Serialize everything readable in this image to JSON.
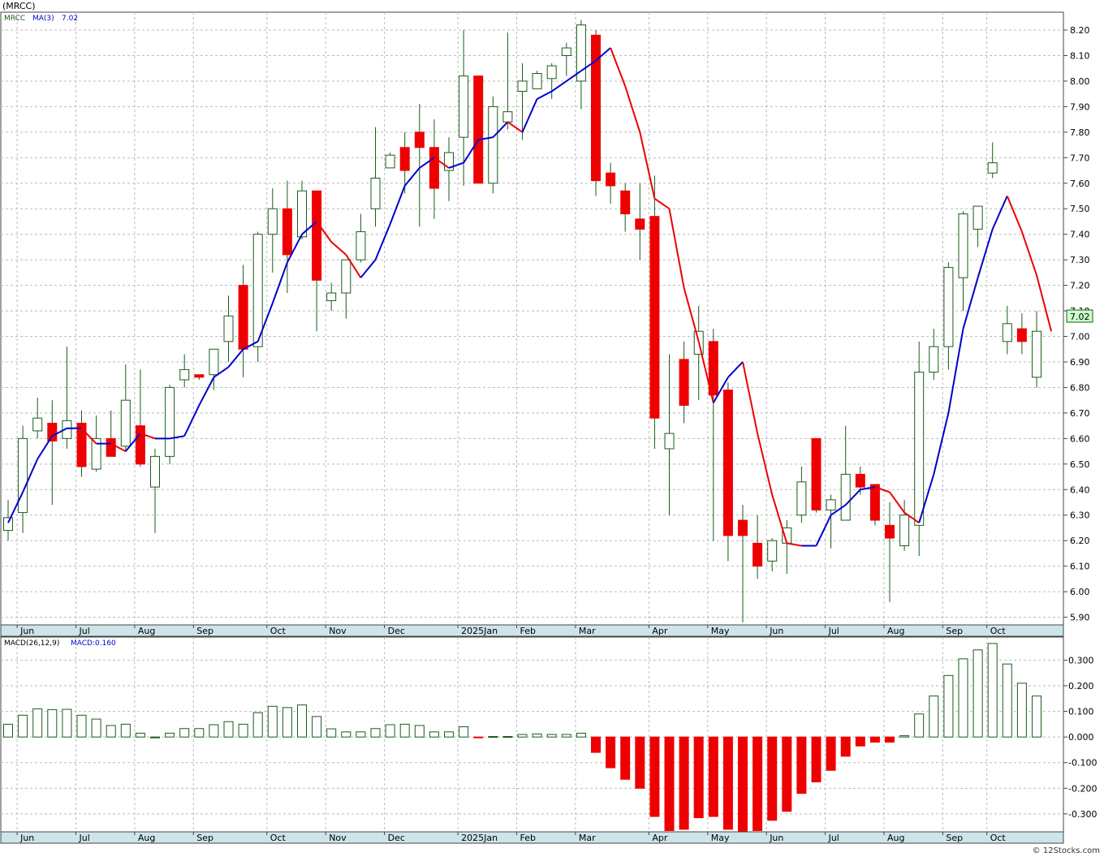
{
  "header_title": "(MRCC)",
  "watermark": "© 12Stocks.com",
  "price_legend": {
    "symbol": "MRCC",
    "ma_label": "MA(3)",
    "ma_value": "7.02"
  },
  "macd_legend": {
    "params": "MACD(26,12,9)",
    "value_label": "MACD:0.160"
  },
  "last_price_tag": "7.02",
  "colors": {
    "up_body": "#ffffff",
    "up_outline": "#1a5c1a",
    "down_body": "#ee0000",
    "ma_up": "#0000cc",
    "ma_down": "#ee0000",
    "grid": "#bbbbbb",
    "axis_band": "#cde4ea",
    "macd_pos": "#1a5c1a",
    "macd_neg": "#ee0000"
  },
  "chart_data": [
    {
      "type": "candlestick",
      "series_name": "MRCC",
      "ylim": [
        5.87,
        8.27
      ],
      "yticks": [
        "5.90",
        "6.00",
        "6.10",
        "6.20",
        "6.30",
        "6.40",
        "6.50",
        "6.60",
        "6.70",
        "6.80",
        "6.90",
        "7.00",
        "7.10",
        "7.20",
        "7.30",
        "7.40",
        "7.50",
        "7.60",
        "7.70",
        "7.80",
        "7.90",
        "8.00",
        "8.10",
        "8.20"
      ],
      "xticks": [
        "Jun",
        "Jul",
        "Aug",
        "Sep",
        "Oct",
        "Nov",
        "Dec",
        "2025Jan",
        "Feb",
        "Mar",
        "Apr",
        "May",
        "Jun",
        "Jul",
        "Aug",
        "Sep",
        "Oct"
      ],
      "xtick_bars": [
        1,
        5,
        9,
        13,
        18,
        22,
        26,
        31,
        35,
        39,
        44,
        48,
        52,
        56,
        60,
        64,
        67
      ],
      "candles": [
        {
          "o": 6.24,
          "h": 6.36,
          "l": 6.2,
          "c": 6.29
        },
        {
          "o": 6.31,
          "h": 6.65,
          "l": 6.23,
          "c": 6.6
        },
        {
          "o": 6.63,
          "h": 6.76,
          "l": 6.6,
          "c": 6.68
        },
        {
          "o": 6.66,
          "h": 6.75,
          "l": 6.34,
          "c": 6.59
        },
        {
          "o": 6.6,
          "h": 6.96,
          "l": 6.56,
          "c": 6.67
        },
        {
          "o": 6.66,
          "h": 6.71,
          "l": 6.45,
          "c": 6.49
        },
        {
          "o": 6.48,
          "h": 6.69,
          "l": 6.47,
          "c": 6.6
        },
        {
          "o": 6.6,
          "h": 6.71,
          "l": 6.53,
          "c": 6.53
        },
        {
          "o": 6.57,
          "h": 6.89,
          "l": 6.55,
          "c": 6.75
        },
        {
          "o": 6.65,
          "h": 6.87,
          "l": 6.49,
          "c": 6.5
        },
        {
          "o": 6.41,
          "h": 6.56,
          "l": 6.23,
          "c": 6.53
        },
        {
          "o": 6.53,
          "h": 6.81,
          "l": 6.5,
          "c": 6.8
        },
        {
          "o": 6.83,
          "h": 6.93,
          "l": 6.8,
          "c": 6.87
        },
        {
          "o": 6.85,
          "h": 6.85,
          "l": 6.83,
          "c": 6.84
        },
        {
          "o": 6.85,
          "h": 6.95,
          "l": 6.79,
          "c": 6.95
        },
        {
          "o": 6.98,
          "h": 7.16,
          "l": 6.9,
          "c": 7.08
        },
        {
          "o": 7.2,
          "h": 7.28,
          "l": 6.84,
          "c": 6.95
        },
        {
          "o": 6.96,
          "h": 7.41,
          "l": 6.9,
          "c": 7.4
        },
        {
          "o": 7.4,
          "h": 7.58,
          "l": 7.25,
          "c": 7.5
        },
        {
          "o": 7.5,
          "h": 7.61,
          "l": 7.17,
          "c": 7.32
        },
        {
          "o": 7.39,
          "h": 7.61,
          "l": 7.38,
          "c": 7.57
        },
        {
          "o": 7.57,
          "h": 7.57,
          "l": 7.02,
          "c": 7.22
        },
        {
          "o": 7.14,
          "h": 7.21,
          "l": 7.1,
          "c": 7.17
        },
        {
          "o": 7.17,
          "h": 7.3,
          "l": 7.07,
          "c": 7.3
        },
        {
          "o": 7.3,
          "h": 7.48,
          "l": 7.29,
          "c": 7.41
        },
        {
          "o": 7.5,
          "h": 7.82,
          "l": 7.43,
          "c": 7.62
        },
        {
          "o": 7.66,
          "h": 7.72,
          "l": 7.66,
          "c": 7.71
        },
        {
          "o": 7.74,
          "h": 7.8,
          "l": 7.56,
          "c": 7.65
        },
        {
          "o": 7.8,
          "h": 7.91,
          "l": 7.43,
          "c": 7.74
        },
        {
          "o": 7.74,
          "h": 7.85,
          "l": 7.46,
          "c": 7.58
        },
        {
          "o": 7.65,
          "h": 7.78,
          "l": 7.53,
          "c": 7.72
        },
        {
          "o": 7.78,
          "h": 8.2,
          "l": 7.59,
          "c": 8.02
        },
        {
          "o": 8.02,
          "h": 8.02,
          "l": 7.6,
          "c": 7.6
        },
        {
          "o": 7.6,
          "h": 7.94,
          "l": 7.56,
          "c": 7.9
        },
        {
          "o": 7.84,
          "h": 8.19,
          "l": 7.81,
          "c": 7.88
        },
        {
          "o": 7.96,
          "h": 8.07,
          "l": 7.77,
          "c": 8.0
        },
        {
          "o": 7.97,
          "h": 8.04,
          "l": 7.97,
          "c": 8.03
        },
        {
          "o": 8.01,
          "h": 8.07,
          "l": 7.93,
          "c": 8.06
        },
        {
          "o": 8.1,
          "h": 8.15,
          "l": 8.02,
          "c": 8.13
        },
        {
          "o": 8.0,
          "h": 8.24,
          "l": 7.89,
          "c": 8.22
        },
        {
          "o": 8.18,
          "h": 8.2,
          "l": 7.55,
          "c": 7.61
        },
        {
          "o": 7.64,
          "h": 7.68,
          "l": 7.52,
          "c": 7.59
        },
        {
          "o": 7.57,
          "h": 7.6,
          "l": 7.41,
          "c": 7.48
        },
        {
          "o": 7.46,
          "h": 7.6,
          "l": 7.3,
          "c": 7.42
        },
        {
          "o": 7.47,
          "h": 7.63,
          "l": 6.56,
          "c": 6.68
        },
        {
          "o": 6.56,
          "h": 6.93,
          "l": 6.3,
          "c": 6.62
        },
        {
          "o": 6.91,
          "h": 6.98,
          "l": 6.66,
          "c": 6.73
        },
        {
          "o": 6.93,
          "h": 7.12,
          "l": 6.75,
          "c": 7.02
        },
        {
          "o": 6.98,
          "h": 7.03,
          "l": 6.2,
          "c": 6.77
        },
        {
          "o": 6.79,
          "h": 6.82,
          "l": 6.12,
          "c": 6.22
        },
        {
          "o": 6.28,
          "h": 6.34,
          "l": 5.88,
          "c": 6.22
        },
        {
          "o": 6.19,
          "h": 6.3,
          "l": 6.05,
          "c": 6.1
        },
        {
          "o": 6.12,
          "h": 6.21,
          "l": 6.08,
          "c": 6.2
        },
        {
          "o": 6.19,
          "h": 6.28,
          "l": 6.07,
          "c": 6.25
        },
        {
          "o": 6.3,
          "h": 6.49,
          "l": 6.27,
          "c": 6.43
        },
        {
          "o": 6.6,
          "h": 6.6,
          "l": 6.31,
          "c": 6.32
        },
        {
          "o": 6.32,
          "h": 6.38,
          "l": 6.17,
          "c": 6.36
        },
        {
          "o": 6.28,
          "h": 6.65,
          "l": 6.28,
          "c": 6.46
        },
        {
          "o": 6.46,
          "h": 6.49,
          "l": 6.38,
          "c": 6.41
        },
        {
          "o": 6.42,
          "h": 6.42,
          "l": 6.26,
          "c": 6.28
        },
        {
          "o": 6.26,
          "h": 6.35,
          "l": 5.96,
          "c": 6.21
        },
        {
          "o": 6.18,
          "h": 6.36,
          "l": 6.16,
          "c": 6.3
        },
        {
          "o": 6.26,
          "h": 6.98,
          "l": 6.14,
          "c": 6.86
        },
        {
          "o": 6.86,
          "h": 7.03,
          "l": 6.83,
          "c": 6.96
        },
        {
          "o": 6.96,
          "h": 7.29,
          "l": 6.87,
          "c": 7.27
        },
        {
          "o": 7.23,
          "h": 7.49,
          "l": 7.1,
          "c": 7.48
        },
        {
          "o": 7.42,
          "h": 7.51,
          "l": 7.35,
          "c": 7.51
        },
        {
          "o": 7.64,
          "h": 7.76,
          "l": 7.62,
          "c": 7.68
        },
        {
          "o": 6.98,
          "h": 7.12,
          "l": 6.93,
          "c": 7.05
        },
        {
          "o": 7.03,
          "h": 7.09,
          "l": 6.93,
          "c": 6.98
        },
        {
          "o": 6.84,
          "h": 7.1,
          "l": 6.8,
          "c": 7.02
        }
      ],
      "ma": [
        6.27,
        6.39,
        6.52,
        6.61,
        6.64,
        6.64,
        6.58,
        6.58,
        6.55,
        6.62,
        6.6,
        6.6,
        6.61,
        6.73,
        6.84,
        6.88,
        6.95,
        6.98,
        7.13,
        7.29,
        7.4,
        7.45,
        7.37,
        7.32,
        7.23,
        7.3,
        7.44,
        7.59,
        7.66,
        7.7,
        7.66,
        7.68,
        7.77,
        7.78,
        7.84,
        7.8,
        7.93,
        7.96,
        8.0,
        8.04,
        8.08,
        8.13,
        7.98,
        7.8,
        7.54,
        7.5,
        7.19,
        6.98,
        6.74,
        6.84,
        6.9,
        6.62,
        6.38,
        6.19,
        6.18,
        6.18,
        6.3,
        6.34,
        6.4,
        6.41,
        6.39,
        6.31,
        6.27,
        6.46,
        6.7,
        7.03,
        7.23,
        7.42,
        7.55,
        7.41,
        7.24,
        7.02
      ],
      "ma_split_at": 48
    },
    {
      "type": "bar",
      "series_name": "MACD(26,12,9)",
      "ylim": [
        -0.37,
        0.39
      ],
      "yticks": [
        "-0.300",
        "-0.200",
        "-0.100",
        "0.000",
        "0.100",
        "0.200",
        "0.300"
      ],
      "values": [
        0.05,
        0.085,
        0.11,
        0.107,
        0.108,
        0.085,
        0.07,
        0.045,
        0.05,
        0.015,
        0.0,
        0.015,
        0.033,
        0.033,
        0.048,
        0.06,
        0.05,
        0.095,
        0.12,
        0.115,
        0.125,
        0.08,
        0.032,
        0.02,
        0.02,
        0.033,
        0.048,
        0.05,
        0.045,
        0.02,
        0.02,
        0.04,
        -0.002,
        0.002,
        0.002,
        0.01,
        0.012,
        0.01,
        0.01,
        0.015,
        -0.06,
        -0.12,
        -0.165,
        -0.2,
        -0.31,
        -0.365,
        -0.36,
        -0.315,
        -0.31,
        -0.36,
        -0.37,
        -0.365,
        -0.325,
        -0.29,
        -0.22,
        -0.175,
        -0.13,
        -0.075,
        -0.035,
        -0.02,
        -0.02,
        0.005,
        0.09,
        0.16,
        0.24,
        0.305,
        0.34,
        0.365,
        0.285,
        0.21,
        0.16
      ]
    }
  ]
}
